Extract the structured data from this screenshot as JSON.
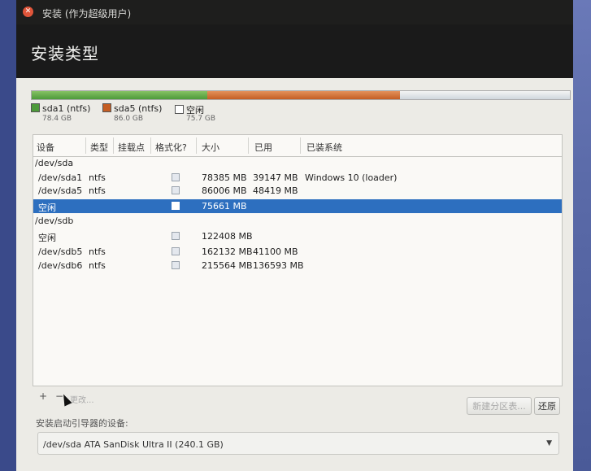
{
  "window": {
    "title": "安装 (作为超级用户)"
  },
  "page": {
    "heading": "安装类型"
  },
  "legend": [
    {
      "name": "sda1 (ntfs)",
      "size": "78.4 GB",
      "color": "#4d9a3a"
    },
    {
      "name": "sda5 (ntfs)",
      "size": "86.0 GB",
      "color": "#c45e24"
    },
    {
      "name": "空闲",
      "size": "75.7 GB",
      "color": "#ffffff"
    }
  ],
  "table": {
    "columns": [
      "设备",
      "类型",
      "挂载点",
      "格式化?",
      "大小",
      "已用",
      "已装系统"
    ],
    "rows": [
      {
        "device": "/dev/sda",
        "type": "",
        "mount": "",
        "format": false,
        "size": "",
        "used": "",
        "system": "",
        "group": true
      },
      {
        "device": "/dev/sda1",
        "type": "ntfs",
        "mount": "",
        "format": false,
        "size": "78385 MB",
        "used": "39147 MB",
        "system": "Windows 10 (loader)"
      },
      {
        "device": "/dev/sda5",
        "type": "ntfs",
        "mount": "",
        "format": false,
        "size": "86006 MB",
        "used": "48419 MB",
        "system": ""
      },
      {
        "device": "空闲",
        "type": "",
        "mount": "",
        "format": false,
        "size": "75661 MB",
        "used": "",
        "system": "",
        "selected": true
      },
      {
        "device": "/dev/sdb",
        "type": "",
        "mount": "",
        "format": false,
        "size": "",
        "used": "",
        "system": "",
        "group": true
      },
      {
        "device": "空闲",
        "type": "",
        "mount": "",
        "format": false,
        "size": "122408 MB",
        "used": "",
        "system": ""
      },
      {
        "device": "/dev/sdb5",
        "type": "ntfs",
        "mount": "",
        "format": false,
        "size": "162132 MB",
        "used": "41100 MB",
        "system": ""
      },
      {
        "device": "/dev/sdb6",
        "type": "ntfs",
        "mount": "",
        "format": false,
        "size": "215564 MB",
        "used": "136593 MB",
        "system": ""
      }
    ]
  },
  "toolbar": {
    "add": "+",
    "remove": "−",
    "change": "更改..."
  },
  "buttons": {
    "new_table": "新建分区表...",
    "revert": "还原"
  },
  "bootloader": {
    "label": "安装启动引导器的设备:",
    "value": "/dev/sda   ATA SanDisk Ultra II (240.1 GB)"
  }
}
